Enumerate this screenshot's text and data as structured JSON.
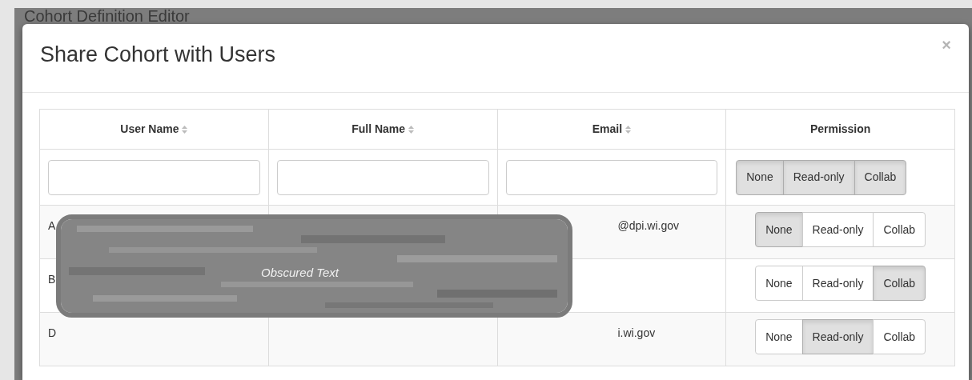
{
  "background_page": {
    "title": "Cohort Definition Editor"
  },
  "modal": {
    "title": "Share Cohort with Users",
    "close": "×"
  },
  "table": {
    "columns": [
      {
        "label": "User Name",
        "sortable": true
      },
      {
        "label": "Full Name",
        "sortable": true
      },
      {
        "label": "Email",
        "sortable": true
      },
      {
        "label": "Permission",
        "sortable": false
      }
    ],
    "filter_permissions": [
      {
        "label": "None",
        "selected": true
      },
      {
        "label": "Read-only",
        "selected": true
      },
      {
        "label": "Collab",
        "selected": true
      }
    ],
    "rows": [
      {
        "user_name": "A",
        "email": "@dpi.wi.gov",
        "permissions": [
          {
            "label": "None",
            "selected": true
          },
          {
            "label": "Read-only",
            "selected": false
          },
          {
            "label": "Collab",
            "selected": false
          }
        ]
      },
      {
        "user_name": "B",
        "permissions": [
          {
            "label": "None",
            "selected": false
          },
          {
            "label": "Read-only",
            "selected": false
          },
          {
            "label": "Collab",
            "selected": true
          }
        ]
      },
      {
        "user_name": "D",
        "email": "i.wi.gov",
        "permissions": [
          {
            "label": "None",
            "selected": false
          },
          {
            "label": "Read-only",
            "selected": true
          },
          {
            "label": "Collab",
            "selected": false
          }
        ]
      }
    ]
  },
  "overlay": {
    "text": "Obscured Text"
  }
}
